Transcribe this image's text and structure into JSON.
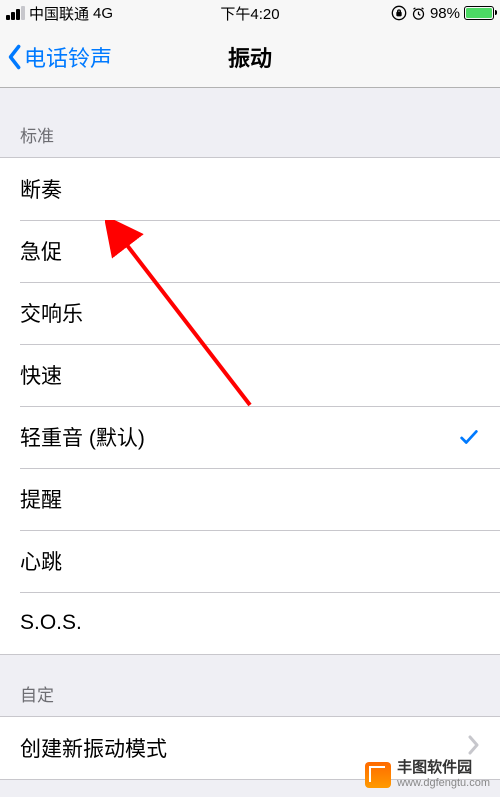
{
  "status": {
    "carrier": "中国联通",
    "network": "4G",
    "time": "下午4:20",
    "battery_pct": "98%"
  },
  "nav": {
    "back_label": "电话铃声",
    "title": "振动"
  },
  "sections": {
    "standard_header": "标准",
    "custom_header": "自定"
  },
  "standard": [
    {
      "label": "断奏",
      "selected": false
    },
    {
      "label": "急促",
      "selected": false
    },
    {
      "label": "交响乐",
      "selected": false
    },
    {
      "label": "快速",
      "selected": false
    },
    {
      "label": "轻重音 (默认)",
      "selected": true
    },
    {
      "label": "提醒",
      "selected": false
    },
    {
      "label": "心跳",
      "selected": false
    },
    {
      "label": "S.O.S.",
      "selected": false
    }
  ],
  "custom": {
    "create_label": "创建新振动模式"
  },
  "watermark": {
    "line1": "丰图软件园",
    "line2": "www.dgfengtu.com"
  }
}
